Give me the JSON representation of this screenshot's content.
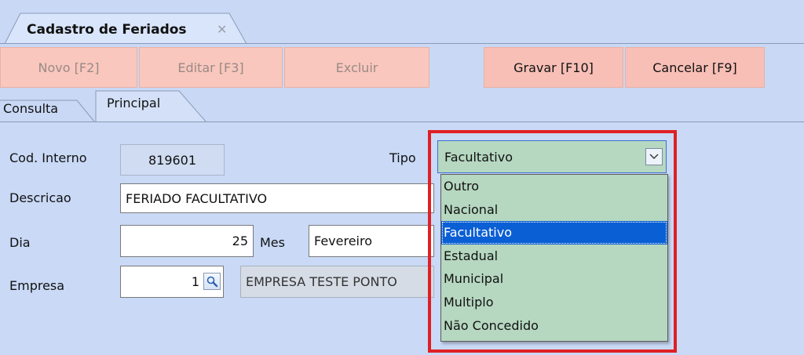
{
  "document_tab": {
    "title": "Cadastro de Feriados",
    "close_glyph": "✕"
  },
  "toolbar": {
    "novo": "Novo [F2]",
    "editar": "Editar [F3]",
    "excluir": "Excluir",
    "gravar": "Gravar [F10]",
    "cancelar": "Cancelar [F9]"
  },
  "subtabs": {
    "consulta": "Consulta",
    "principal": "Principal"
  },
  "form": {
    "cod_interno": {
      "label": "Cod. Interno",
      "value": "819601"
    },
    "tipo": {
      "label": "Tipo",
      "value": "Facultativo"
    },
    "descricao": {
      "label": "Descricao",
      "value": "FERIADO FACULTATIVO"
    },
    "dia": {
      "label": "Dia",
      "value": "25"
    },
    "mes": {
      "label": "Mes",
      "value": "Fevereiro"
    },
    "empresa": {
      "label": "Empresa",
      "code": "1",
      "name": "EMPRESA TESTE PONTO"
    }
  },
  "tipo_options": [
    "Outro",
    "Nacional",
    "Facultativo",
    "Estadual",
    "Municipal",
    "Multiplo",
    "Não Concedido"
  ],
  "tipo_selected_index": 2,
  "colors": {
    "background": "#c8d8f5",
    "toolbar_button": "#f9c7bd",
    "combo": "#b6d7c0",
    "selection": "#0b5fd4",
    "highlight": "#e01f24"
  },
  "icons": {
    "lookup": "magnifier-icon",
    "dropdown": "chevron-down-icon",
    "close": "close-icon"
  }
}
